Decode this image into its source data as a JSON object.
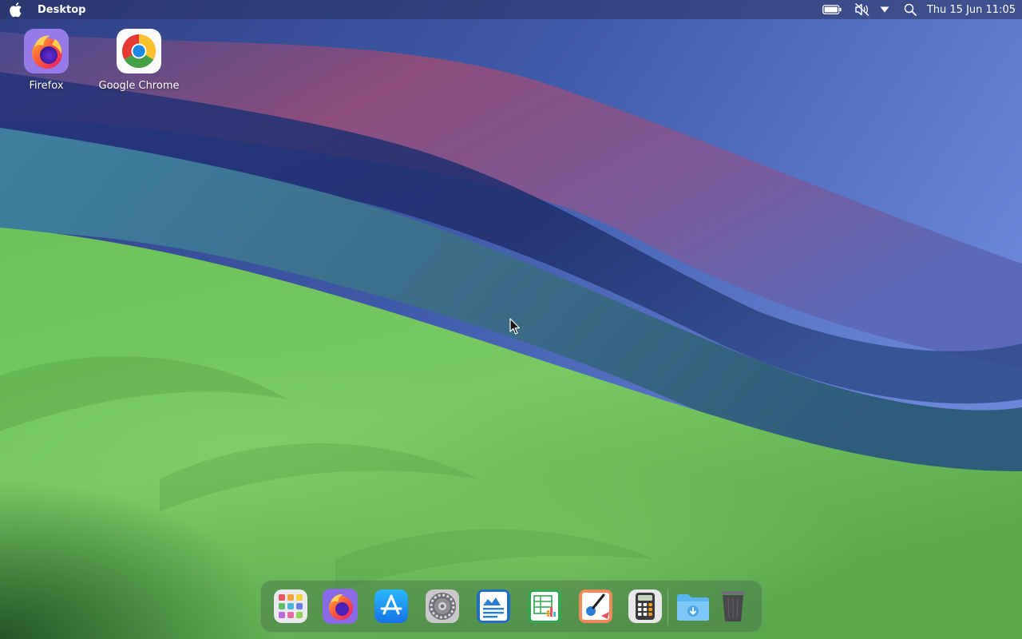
{
  "menubar": {
    "apple_icon": "apple-logo-icon",
    "app_name": "Desktop",
    "status_icons": [
      "battery-icon",
      "sound-muted-icon",
      "dropdown-arrow-icon",
      "search-icon"
    ],
    "clock": "Thu 15 Jun 11:05"
  },
  "desktop_icons": [
    {
      "label": "Firefox",
      "icon": "firefox-icon"
    },
    {
      "label": "Google Chrome",
      "icon": "chrome-icon"
    }
  ],
  "dock": {
    "items": [
      {
        "name": "launchpad",
        "icon": "launchpad-icon"
      },
      {
        "name": "firefox",
        "icon": "firefox-icon"
      },
      {
        "name": "app-store",
        "icon": "app-store-icon"
      },
      {
        "name": "system-settings",
        "icon": "gear-icon"
      },
      {
        "name": "writer",
        "icon": "document-icon"
      },
      {
        "name": "spreadsheet",
        "icon": "spreadsheet-icon"
      },
      {
        "name": "paint",
        "icon": "paint-icon"
      },
      {
        "name": "calculator",
        "icon": "calculator-icon"
      },
      {
        "name": "downloads",
        "icon": "downloads-folder-icon"
      },
      {
        "name": "trash",
        "icon": "trash-icon"
      }
    ]
  },
  "colors": {
    "menubar_text": "#ffffff",
    "wallpaper_green": "#6fc45a",
    "wallpaper_blue": "#3a4d9a",
    "wallpaper_purple": "#8a4a7a"
  }
}
